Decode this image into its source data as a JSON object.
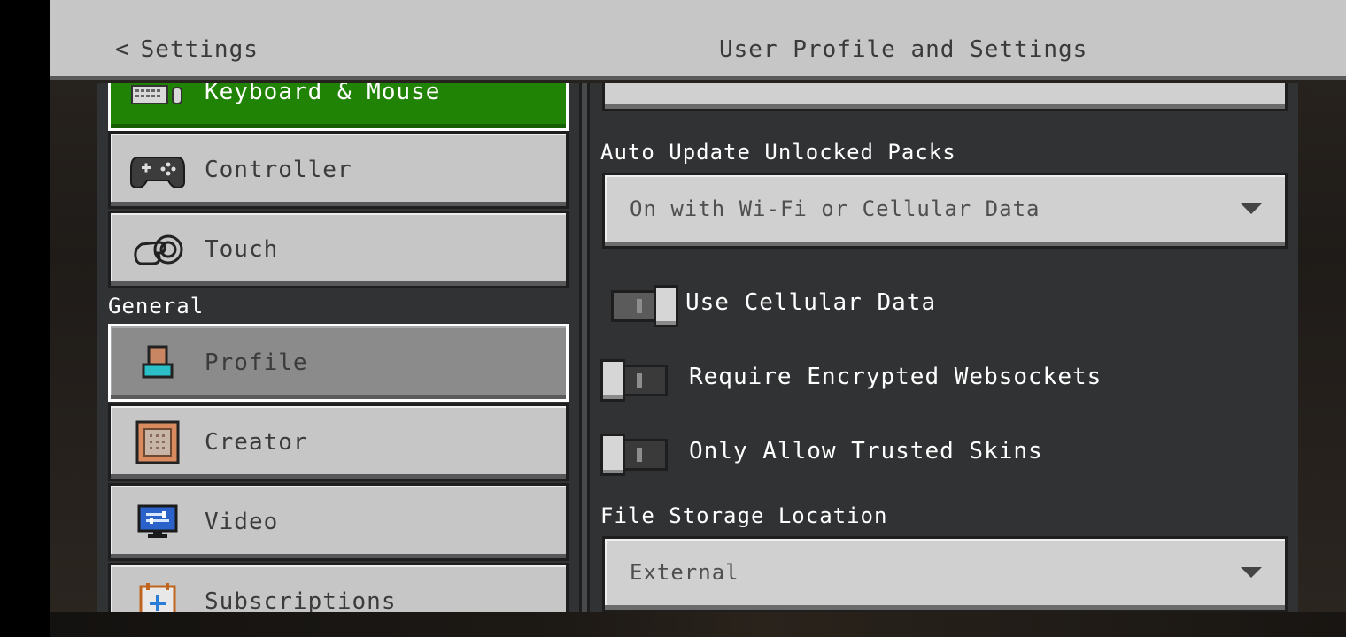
{
  "header": {
    "back_label": "Settings",
    "title": "User Profile and Settings"
  },
  "sidebar": {
    "items_top": [
      {
        "label": "Keyboard & Mouse",
        "icon": "keyboard-mouse-icon",
        "state": "selected"
      },
      {
        "label": "Controller",
        "icon": "controller-icon",
        "state": "normal"
      },
      {
        "label": "Touch",
        "icon": "touch-icon",
        "state": "normal"
      }
    ],
    "section_general": "General",
    "items_general": [
      {
        "label": "Profile",
        "icon": "profile-icon",
        "state": "active"
      },
      {
        "label": "Creator",
        "icon": "creator-icon",
        "state": "normal"
      },
      {
        "label": "Video",
        "icon": "video-icon",
        "state": "normal"
      },
      {
        "label": "Subscriptions",
        "icon": "subscriptions-icon",
        "state": "normal"
      }
    ]
  },
  "settings": {
    "auto_update": {
      "label": "Auto Update Unlocked Packs",
      "value": "On with Wi-Fi or Cellular Data"
    },
    "toggles": [
      {
        "label": "Use Cellular Data",
        "on": true
      },
      {
        "label": "Require Encrypted Websockets",
        "on": false
      },
      {
        "label": "Only Allow Trusted Skins",
        "on": false
      }
    ],
    "file_storage": {
      "label": "File Storage Location",
      "value": "External"
    }
  },
  "colors": {
    "selected_green": "#218306",
    "panel_bg": "#313233",
    "button_gray": "#c6c6c6"
  }
}
